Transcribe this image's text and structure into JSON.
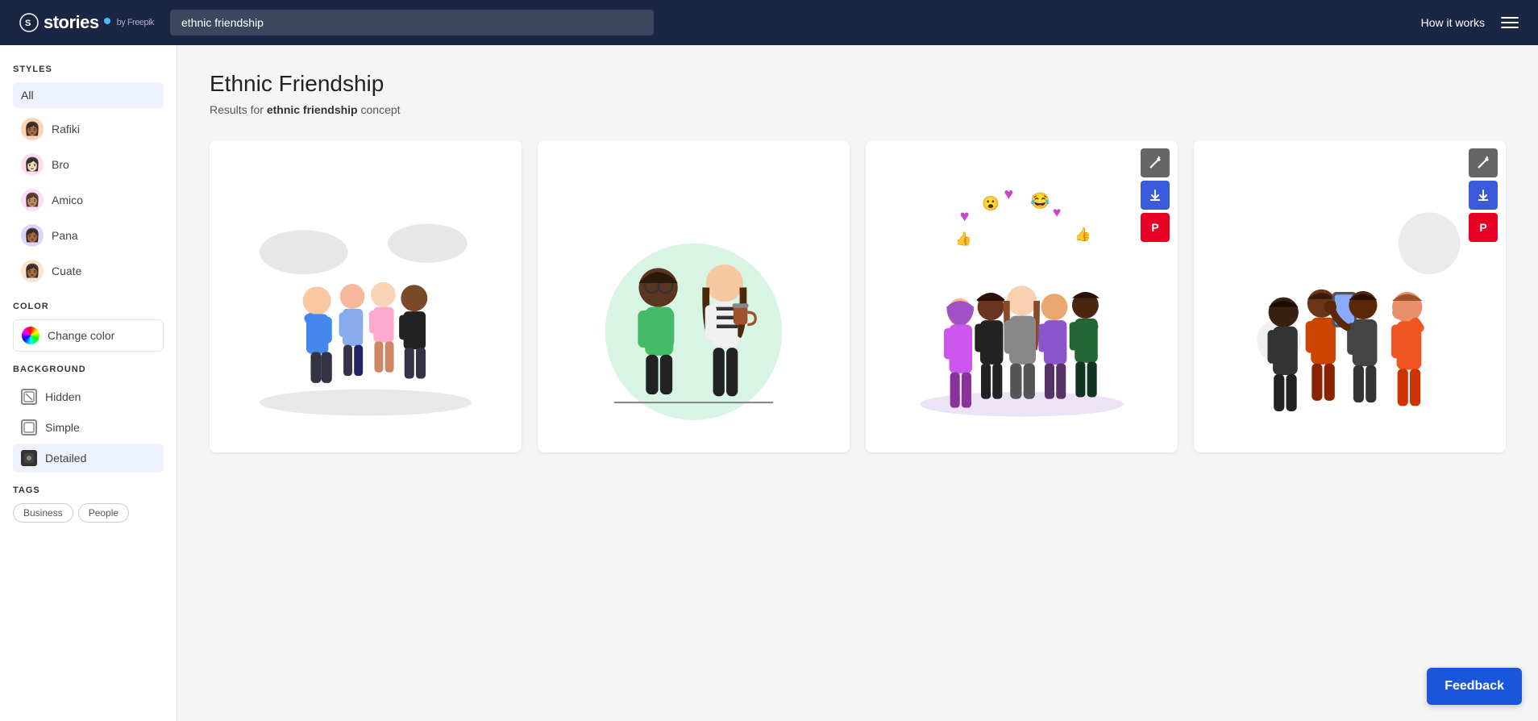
{
  "header": {
    "logo_text": "stories",
    "logo_subtext": "by Freepik",
    "search_value": "ethnic friendship",
    "nav_link": "How it works"
  },
  "sidebar": {
    "styles_label": "STYLES",
    "all_label": "All",
    "style_items": [
      {
        "id": "rafiki",
        "label": "Rafiki",
        "emoji": "👩🏾"
      },
      {
        "id": "bro",
        "label": "Bro",
        "emoji": "👩🏻"
      },
      {
        "id": "amico",
        "label": "Amico",
        "emoji": "👩🏽"
      },
      {
        "id": "pana",
        "label": "Pana",
        "emoji": "👩🏾"
      },
      {
        "id": "cuate",
        "label": "Cuate",
        "emoji": "👩🏾"
      }
    ],
    "color_label": "COLOR",
    "change_color_label": "Change color",
    "background_label": "BACKGROUND",
    "bg_items": [
      {
        "id": "hidden",
        "label": "Hidden"
      },
      {
        "id": "simple",
        "label": "Simple"
      },
      {
        "id": "detailed",
        "label": "Detailed",
        "active": true
      }
    ],
    "tags_label": "TAGS",
    "tags": [
      "Business",
      "People"
    ]
  },
  "main": {
    "page_title": "Ethnic Friendship",
    "results_prefix": "Results for ",
    "results_query": "ethnic friendship",
    "results_suffix": " concept",
    "illustrations": [
      {
        "id": "illus-1",
        "alt": "Group of diverse friends waving"
      },
      {
        "id": "illus-2",
        "alt": "Two people talking outdoors"
      },
      {
        "id": "illus-3",
        "alt": "Group of diverse people with hearts and emojis"
      },
      {
        "id": "illus-4",
        "alt": "Group of people taking selfie"
      }
    ]
  },
  "footer": {
    "feedback_label": "Feedback"
  },
  "icons": {
    "customize": "✏",
    "download": "⬇",
    "pinterest": "P",
    "hamburger": "☰"
  }
}
